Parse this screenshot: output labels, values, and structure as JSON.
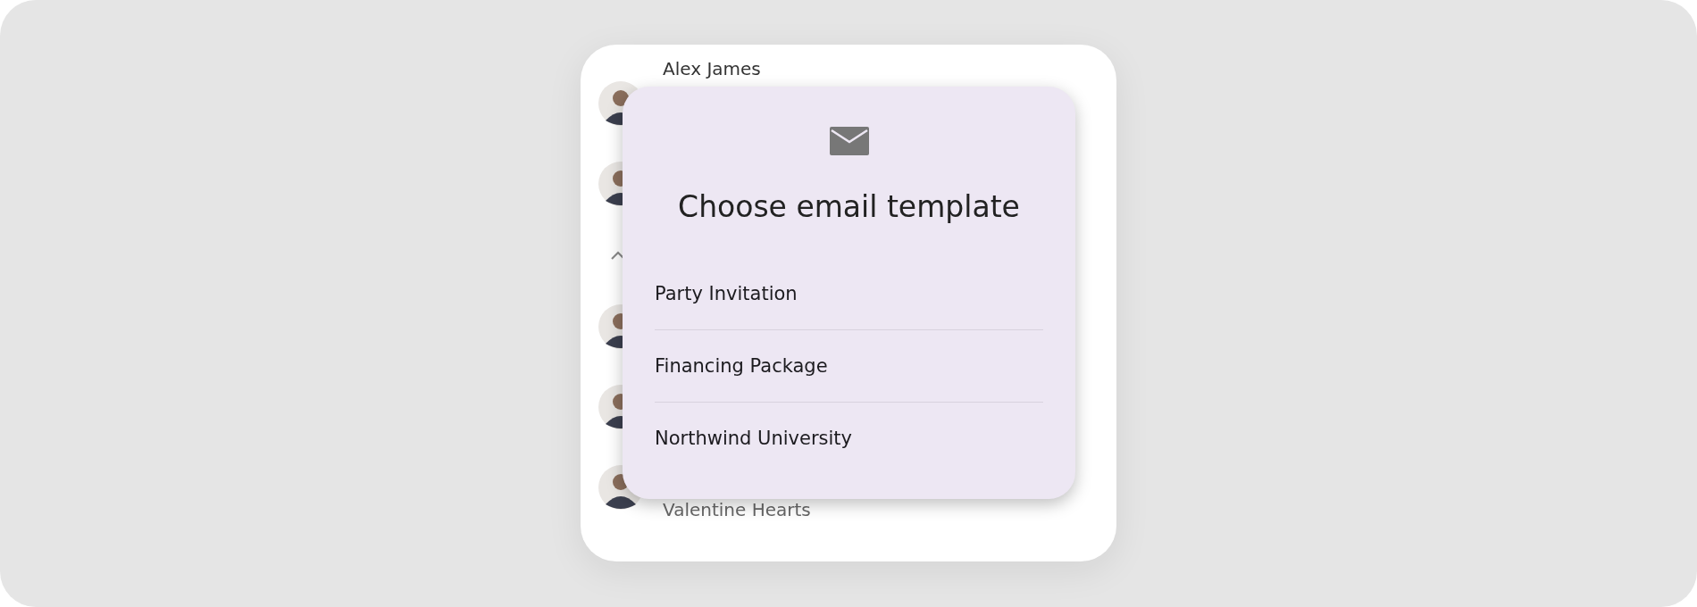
{
  "contacts": [
    {
      "kind": "contact",
      "name": "Alex James"
    },
    {
      "kind": "contact"
    },
    {
      "kind": "group_toggle",
      "expanded": true
    },
    {
      "kind": "contact"
    },
    {
      "kind": "contact"
    },
    {
      "kind": "contact",
      "name": "Valentine Hearts"
    }
  ],
  "dialog": {
    "title": "Choose email template",
    "templates": [
      "Party Invitation",
      "Financing Package",
      "Northwind University"
    ]
  }
}
